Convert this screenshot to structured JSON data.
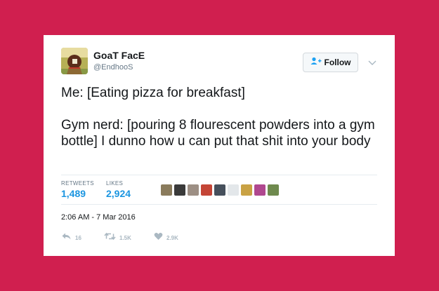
{
  "tweet": {
    "display_name": "GoaT FacE",
    "handle": "@EndhooS",
    "follow_label": "Follow",
    "text_line_1": "Me: [Eating pizza for breakfast]",
    "text_line_2": "Gym nerd: [pouring 8 flourescent powders into a gym bottle] I dunno how u can put that shit into your body",
    "timestamp": "2:06 AM - 7 Mar 2016"
  },
  "stats": {
    "retweets_label": "RETWEETS",
    "retweets_value": "1,489",
    "likes_label": "LIKES",
    "likes_value": "2,924"
  },
  "actions": {
    "reply_count": "16",
    "retweet_count": "1.5K",
    "like_count": "2.9K"
  },
  "icons": {
    "follow": "person-add-icon",
    "caret": "chevron-down-icon",
    "reply": "reply-icon",
    "retweet": "retweet-icon",
    "like": "heart-icon"
  },
  "colors": {
    "background": "#d01f4f",
    "card": "#ffffff",
    "link_blue": "#1b95e0",
    "muted": "#657786",
    "action_gray": "#aab8c2"
  }
}
